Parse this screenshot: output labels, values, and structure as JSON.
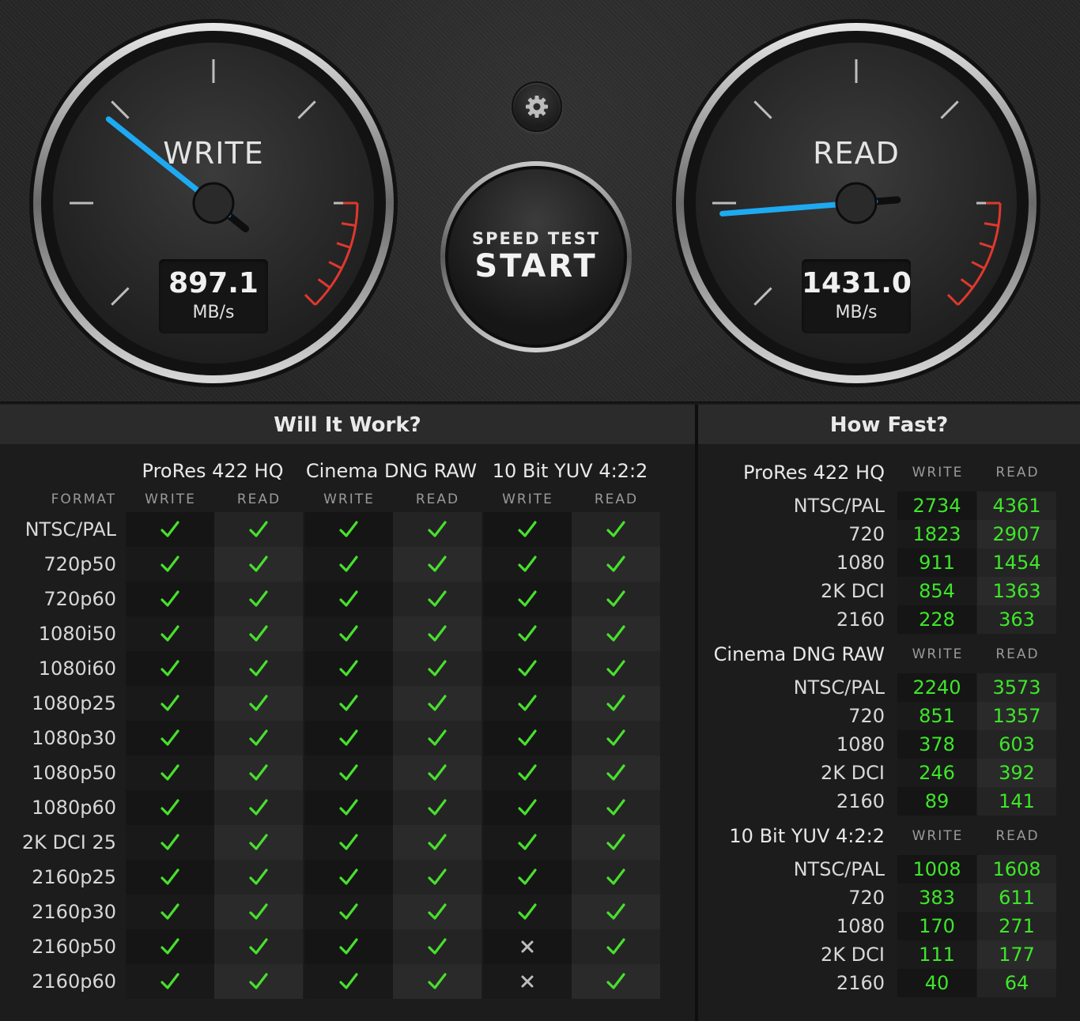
{
  "colors": {
    "accent": "#1eaaf2",
    "ok": "#48e02e",
    "fail": "#bdbdbd",
    "redzone": "#e0382e"
  },
  "write_gauge": {
    "title": "WRITE",
    "value": "897.1",
    "unit": "MB/s",
    "needle_fraction": 0.31
  },
  "read_gauge": {
    "title": "READ",
    "value": "1431.0",
    "unit": "MB/s",
    "needle_fraction": 0.15
  },
  "start": {
    "line1": "SPEED TEST",
    "line2": "START"
  },
  "settings": {
    "icon": "gear-icon"
  },
  "will_it_work": {
    "title": "Will It Work?",
    "format_label": "FORMAT",
    "codecs": [
      "ProRes 422 HQ",
      "Cinema DNG RAW",
      "10 Bit YUV 4:2:2"
    ],
    "subheads": [
      "WRITE",
      "READ",
      "WRITE",
      "READ",
      "WRITE",
      "READ"
    ],
    "rows": [
      {
        "format": "NTSC/PAL",
        "results": [
          true,
          true,
          true,
          true,
          true,
          true
        ]
      },
      {
        "format": "720p50",
        "results": [
          true,
          true,
          true,
          true,
          true,
          true
        ]
      },
      {
        "format": "720p60",
        "results": [
          true,
          true,
          true,
          true,
          true,
          true
        ]
      },
      {
        "format": "1080i50",
        "results": [
          true,
          true,
          true,
          true,
          true,
          true
        ]
      },
      {
        "format": "1080i60",
        "results": [
          true,
          true,
          true,
          true,
          true,
          true
        ]
      },
      {
        "format": "1080p25",
        "results": [
          true,
          true,
          true,
          true,
          true,
          true
        ]
      },
      {
        "format": "1080p30",
        "results": [
          true,
          true,
          true,
          true,
          true,
          true
        ]
      },
      {
        "format": "1080p50",
        "results": [
          true,
          true,
          true,
          true,
          true,
          true
        ]
      },
      {
        "format": "1080p60",
        "results": [
          true,
          true,
          true,
          true,
          true,
          true
        ]
      },
      {
        "format": "2K DCI 25",
        "results": [
          true,
          true,
          true,
          true,
          true,
          true
        ]
      },
      {
        "format": "2160p25",
        "results": [
          true,
          true,
          true,
          true,
          true,
          true
        ]
      },
      {
        "format": "2160p30",
        "results": [
          true,
          true,
          true,
          true,
          true,
          true
        ]
      },
      {
        "format": "2160p50",
        "results": [
          true,
          true,
          true,
          true,
          false,
          true
        ]
      },
      {
        "format": "2160p60",
        "results": [
          true,
          true,
          true,
          true,
          false,
          true
        ]
      }
    ]
  },
  "how_fast": {
    "title": "How Fast?",
    "write_label": "WRITE",
    "read_label": "READ",
    "blocks": [
      {
        "codec": "ProRes 422 HQ",
        "rows": [
          {
            "format": "NTSC/PAL",
            "write": "2734",
            "read": "4361"
          },
          {
            "format": "720",
            "write": "1823",
            "read": "2907"
          },
          {
            "format": "1080",
            "write": "911",
            "read": "1454"
          },
          {
            "format": "2K DCI",
            "write": "854",
            "read": "1363"
          },
          {
            "format": "2160",
            "write": "228",
            "read": "363"
          }
        ]
      },
      {
        "codec": "Cinema DNG RAW",
        "rows": [
          {
            "format": "NTSC/PAL",
            "write": "2240",
            "read": "3573"
          },
          {
            "format": "720",
            "write": "851",
            "read": "1357"
          },
          {
            "format": "1080",
            "write": "378",
            "read": "603"
          },
          {
            "format": "2K DCI",
            "write": "246",
            "read": "392"
          },
          {
            "format": "2160",
            "write": "89",
            "read": "141"
          }
        ]
      },
      {
        "codec": "10 Bit YUV 4:2:2",
        "rows": [
          {
            "format": "NTSC/PAL",
            "write": "1008",
            "read": "1608"
          },
          {
            "format": "720",
            "write": "383",
            "read": "611"
          },
          {
            "format": "1080",
            "write": "170",
            "read": "271"
          },
          {
            "format": "2K DCI",
            "write": "111",
            "read": "177"
          },
          {
            "format": "2160",
            "write": "40",
            "read": "64"
          }
        ]
      }
    ]
  }
}
